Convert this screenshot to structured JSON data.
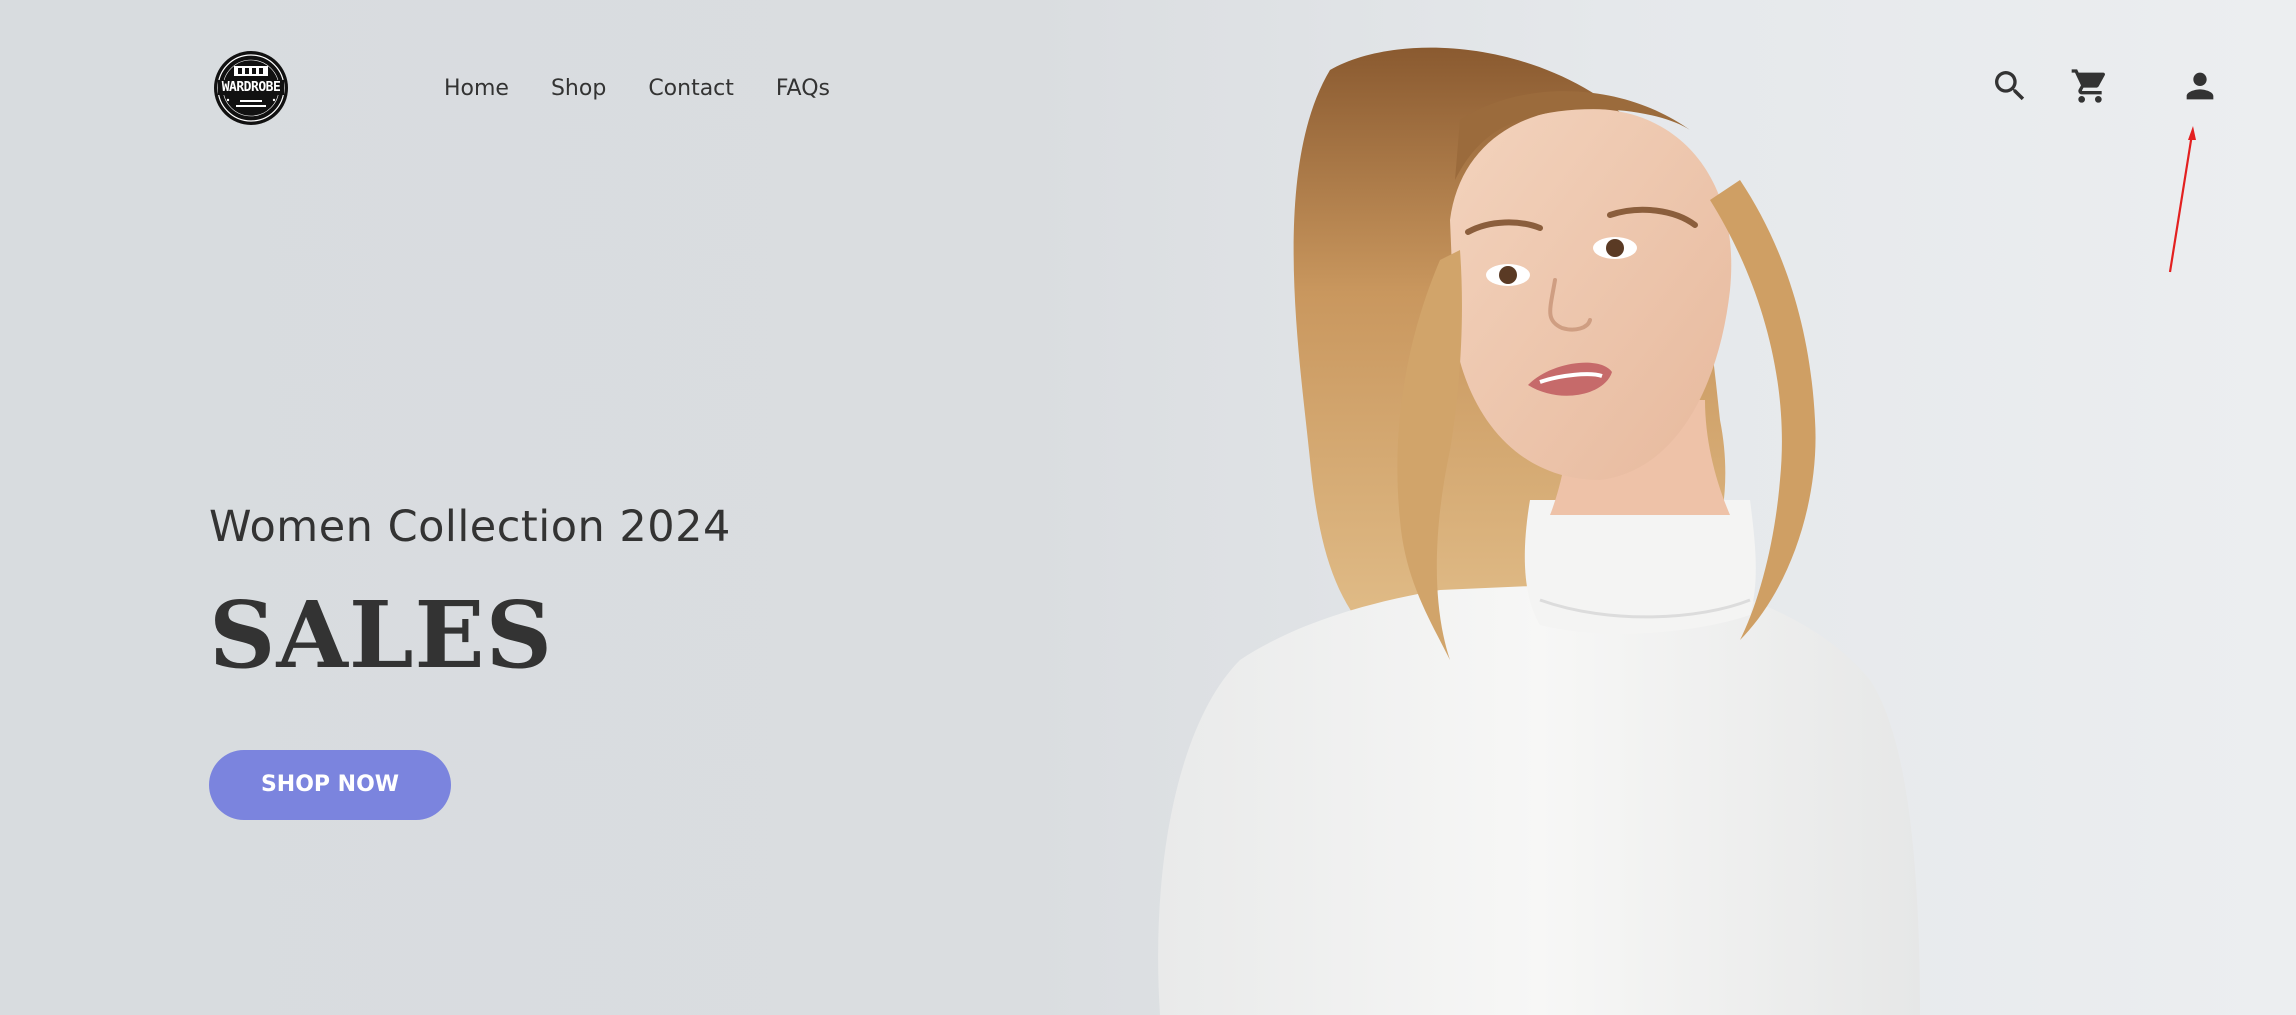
{
  "brand": {
    "logo_text": "WARDROBE"
  },
  "nav": {
    "items": [
      {
        "label": "Home"
      },
      {
        "label": "Shop"
      },
      {
        "label": "Contact"
      },
      {
        "label": "FAQs"
      }
    ]
  },
  "header_icons": [
    "search-icon",
    "cart-icon",
    "user-icon"
  ],
  "hero": {
    "subtitle": "Women Collection 2024",
    "title": "SALES",
    "cta_label": "SHOP NOW"
  },
  "colors": {
    "background": "#d8dcdf",
    "text": "#333333",
    "cta_background": "#7b84de",
    "cta_text": "#ffffff",
    "annotation_arrow": "#e32020"
  }
}
